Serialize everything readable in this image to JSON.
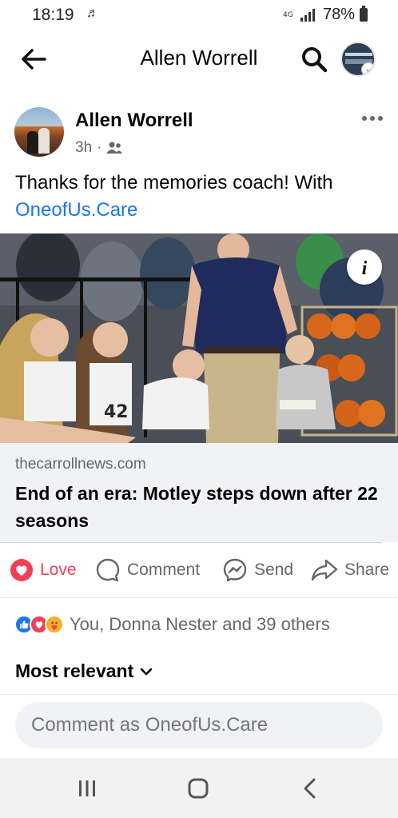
{
  "status_bar": {
    "time": "18:19",
    "battery": "78%"
  },
  "header": {
    "title": "Allen Worrell"
  },
  "post": {
    "author": "Allen Worrell",
    "time_ago": "3h",
    "text": "Thanks for the memories coach! With ",
    "text_link": "OneofUs.Care",
    "image_jersey_number": "42",
    "link_card": {
      "domain": "thecarrollnews.com",
      "title": "End of an era: Motley steps down after 22 seasons"
    }
  },
  "actions": {
    "love": "Love",
    "comment": "Comment",
    "send": "Send",
    "share": "Share"
  },
  "reactions": {
    "text": "You, Donna Nester and 39 others"
  },
  "comments": {
    "sort_label": "Most relevant",
    "input_placeholder": "Comment as OneofUs.Care"
  },
  "colors": {
    "brand_blue": "#1877f2",
    "love_red": "#f33e58",
    "care_yellow": "#f7b125",
    "secondary_text": "#65676b"
  },
  "icons": [
    "signal-icon",
    "battery-icon",
    "back-arrow-icon",
    "search-icon",
    "more-icon",
    "friends-icon",
    "info-icon",
    "heart-icon",
    "comment-icon",
    "messenger-icon",
    "share-icon",
    "chevron-down-icon"
  ]
}
